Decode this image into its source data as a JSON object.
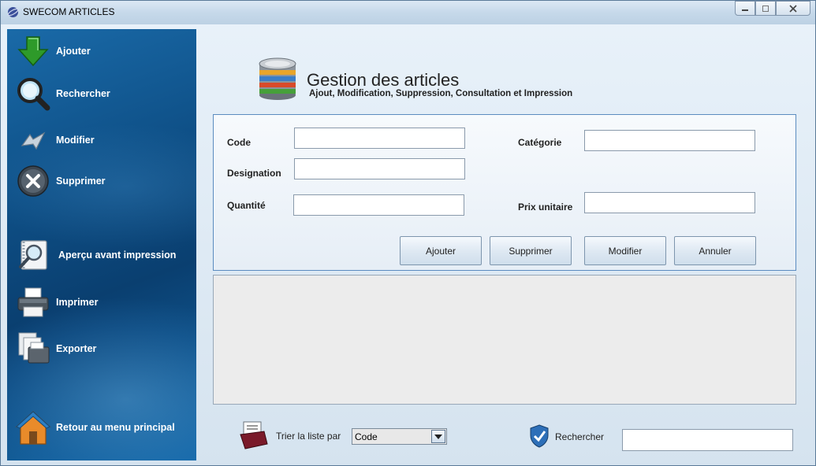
{
  "window": {
    "title": "SWECOM ARTICLES"
  },
  "sidebar": {
    "items": [
      {
        "label": "Ajouter",
        "icon": "green-down-arrow-icon"
      },
      {
        "label": "Rechercher",
        "icon": "magnifier-icon"
      },
      {
        "label": "Modifier",
        "icon": "edit-arrow-icon"
      },
      {
        "label": "Supprimer",
        "icon": "close-circle-icon"
      },
      {
        "label": "Aperçu avant impression",
        "icon": "print-preview-icon"
      },
      {
        "label": "Imprimer",
        "icon": "printer-icon"
      },
      {
        "label": "Exporter",
        "icon": "export-icon"
      },
      {
        "label": "Retour au menu principal",
        "icon": "home-icon"
      }
    ]
  },
  "header": {
    "title": "Gestion des articles",
    "subtitle": "Ajout, Modification, Suppression, Consultation et Impression"
  },
  "form": {
    "code_label": "Code",
    "code_value": "",
    "designation_label": "Designation",
    "designation_value": "",
    "quantite_label": "Quantité",
    "quantite_value": "",
    "categorie_label": "Catégorie",
    "categorie_value": "",
    "prix_label": "Prix unitaire",
    "prix_value": ""
  },
  "buttons": {
    "ajouter": "Ajouter",
    "supprimer": "Supprimer",
    "modifier": "Modifier",
    "annuler": "Annuler"
  },
  "bottom": {
    "sort_label": "Trier la liste par",
    "sort_value": "Code",
    "search_label": "Rechercher",
    "search_value": ""
  },
  "colors": {
    "sidebar": "#0e4f86",
    "panel_border": "#5b8cc0",
    "accent_green": "#2e9a2a"
  }
}
